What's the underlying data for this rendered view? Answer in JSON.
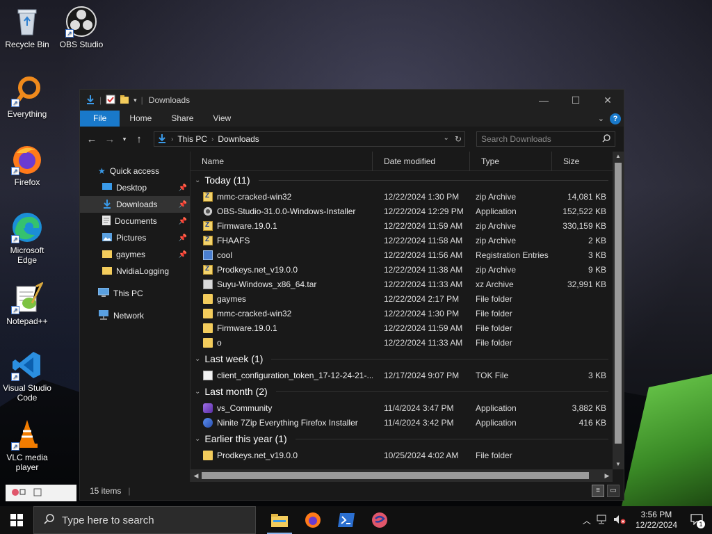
{
  "desktop": {
    "icons": [
      {
        "label": "Recycle Bin"
      },
      {
        "label": "OBS Studio"
      },
      {
        "label": "Everything"
      },
      {
        "label": "Firefox"
      },
      {
        "label": "Microsoft Edge"
      },
      {
        "label": "Notepad++"
      },
      {
        "label": "Visual Studio Code"
      },
      {
        "label": "VLC media player"
      }
    ]
  },
  "window": {
    "title": "Downloads",
    "ribbon_tabs": [
      "File",
      "Home",
      "Share",
      "View"
    ],
    "address": {
      "segments": [
        "This PC",
        "Downloads"
      ]
    },
    "search_placeholder": "Search Downloads",
    "nav": [
      {
        "label": "Quick access"
      },
      {
        "label": "Desktop"
      },
      {
        "label": "Downloads"
      },
      {
        "label": "Documents"
      },
      {
        "label": "Pictures"
      },
      {
        "label": "gaymes"
      },
      {
        "label": "NvidiaLogging"
      },
      {
        "label": "This PC"
      },
      {
        "label": "Network"
      }
    ],
    "columns": [
      "Name",
      "Date modified",
      "Type",
      "Size"
    ],
    "groups": [
      {
        "title": "Today (11)",
        "rows": [
          {
            "icon": "zip",
            "name": "mmc-cracked-win32",
            "date": "12/22/2024 1:30 PM",
            "type": "zip Archive",
            "size": "14,081 KB"
          },
          {
            "icon": "app",
            "name": "OBS-Studio-31.0.0-Windows-Installer",
            "date": "12/22/2024 12:29 PM",
            "type": "Application",
            "size": "152,522 KB"
          },
          {
            "icon": "zip",
            "name": "Firmware.19.0.1",
            "date": "12/22/2024 11:59 AM",
            "type": "zip Archive",
            "size": "330,159 KB"
          },
          {
            "icon": "zip",
            "name": "FHAAFS",
            "date": "12/22/2024 11:58 AM",
            "type": "zip Archive",
            "size": "2 KB"
          },
          {
            "icon": "reg",
            "name": "cool",
            "date": "12/22/2024 11:56 AM",
            "type": "Registration Entries",
            "size": "3 KB"
          },
          {
            "icon": "zip",
            "name": "Prodkeys.net_v19.0.0",
            "date": "12/22/2024 11:38 AM",
            "type": "zip Archive",
            "size": "9 KB"
          },
          {
            "icon": "xz",
            "name": "Suyu-Windows_x86_64.tar",
            "date": "12/22/2024 11:33 AM",
            "type": "xz Archive",
            "size": "32,991 KB"
          },
          {
            "icon": "folder",
            "name": "gaymes",
            "date": "12/22/2024 2:17 PM",
            "type": "File folder",
            "size": ""
          },
          {
            "icon": "folder",
            "name": "mmc-cracked-win32",
            "date": "12/22/2024 1:30 PM",
            "type": "File folder",
            "size": ""
          },
          {
            "icon": "folder",
            "name": "Firmware.19.0.1",
            "date": "12/22/2024 11:59 AM",
            "type": "File folder",
            "size": ""
          },
          {
            "icon": "folder",
            "name": "o",
            "date": "12/22/2024 11:33 AM",
            "type": "File folder",
            "size": ""
          }
        ]
      },
      {
        "title": "Last week (1)",
        "rows": [
          {
            "icon": "doc",
            "name": "client_configuration_token_17-12-24-21-...",
            "date": "12/17/2024 9:07 PM",
            "type": "TOK File",
            "size": "3 KB"
          }
        ]
      },
      {
        "title": "Last month (2)",
        "rows": [
          {
            "icon": "vs",
            "name": "vs_Community",
            "date": "11/4/2024 3:47 PM",
            "type": "Application",
            "size": "3,882 KB"
          },
          {
            "icon": "ninite",
            "name": "Ninite 7Zip Everything Firefox Installer",
            "date": "11/4/2024 3:42 PM",
            "type": "Application",
            "size": "416 KB"
          }
        ]
      },
      {
        "title": "Earlier this year (1)",
        "rows": [
          {
            "icon": "folder",
            "name": "Prodkeys.net_v19.0.0",
            "date": "10/25/2024 4:02 AM",
            "type": "File folder",
            "size": ""
          }
        ]
      }
    ],
    "status": "15 items"
  },
  "taskbar": {
    "search_placeholder": "Type here to search",
    "time": "3:56 PM",
    "date": "12/22/2024",
    "notification_count": "1"
  }
}
